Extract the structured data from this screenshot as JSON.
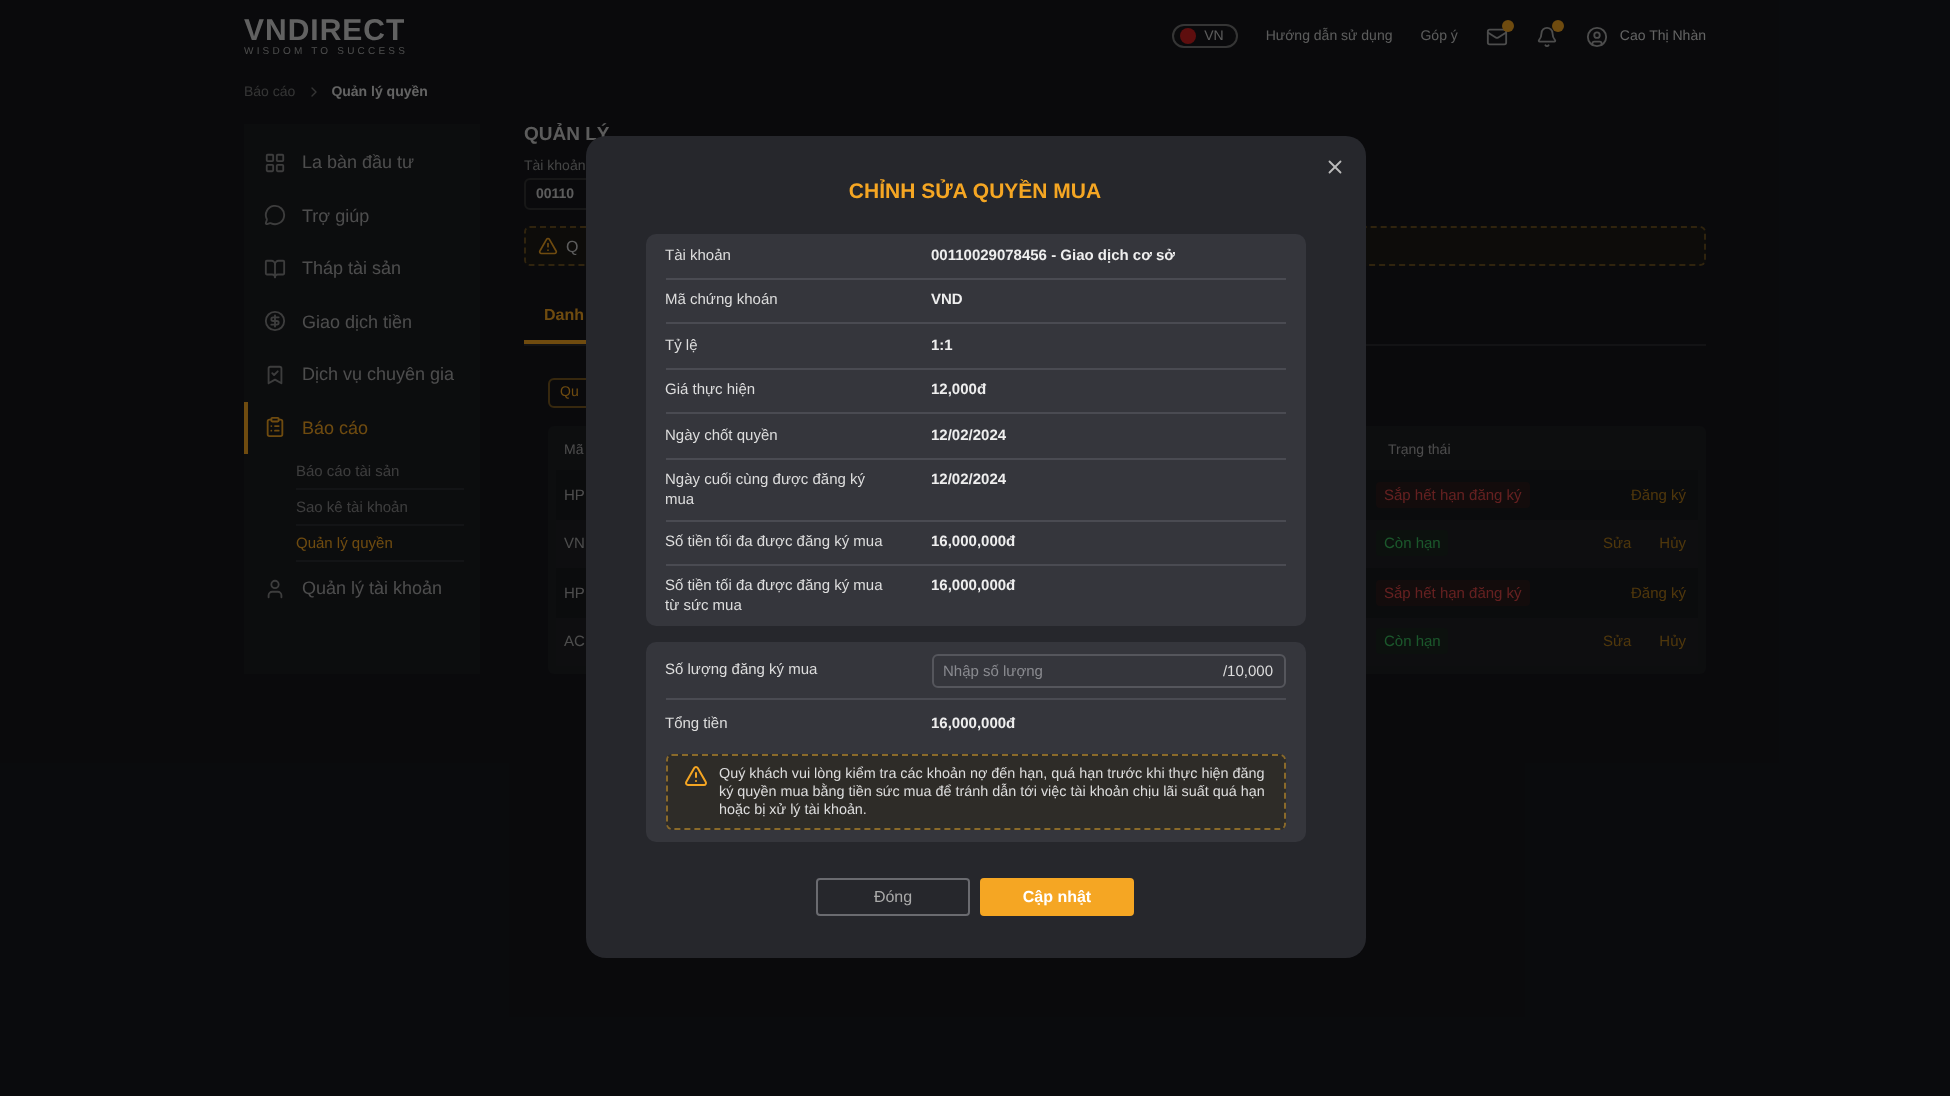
{
  "header": {
    "logo": "VNDIRECT",
    "tagline": "WISDOM TO SUCCESS",
    "language": "VN",
    "links": [
      "Hướng dẫn sử dụng",
      "Góp ý"
    ],
    "user_name": "Cao Thị Nhàn"
  },
  "breadcrumb": [
    "Báo cáo",
    "Quản lý quyền"
  ],
  "sidebar": {
    "items": [
      {
        "label": "La bàn đầu tư",
        "kind": "compass",
        "selected": false
      },
      {
        "label": "Trợ giúp",
        "kind": "help",
        "selected": false
      },
      {
        "label": "Tháp tài sản",
        "kind": "book",
        "selected": false
      },
      {
        "label": "Giao dịch tiền",
        "kind": "money",
        "selected": false
      },
      {
        "label": "Dịch vụ chuyên gia",
        "kind": "badge",
        "selected": false
      },
      {
        "label": "Báo cáo",
        "kind": "report",
        "selected": true,
        "children": [
          {
            "label": "Báo cáo tài sản",
            "selected": false
          },
          {
            "label": "Sao kê tài khoản",
            "selected": false
          },
          {
            "label": "Quản lý quyền",
            "selected": true
          }
        ]
      },
      {
        "label": "Quản lý tài khoản",
        "kind": "user",
        "selected": false
      }
    ]
  },
  "page": {
    "title": "QUẢN LÝ",
    "account_label": "Tài khoản",
    "account_value": "00110",
    "notice": "Q",
    "tabs": [
      {
        "label": "Danh",
        "selected": true
      }
    ],
    "filter_button": "Qu",
    "table": {
      "columns": [
        "Mã",
        "Trạng thái"
      ],
      "rows": [
        {
          "code": "HP",
          "status": {
            "label": "Sắp hết hạn đăng ký",
            "kind": "expiring"
          },
          "actions": [
            "Đăng ký"
          ]
        },
        {
          "code": "VN",
          "status": {
            "label": "Còn hạn",
            "kind": "valid"
          },
          "actions": [
            "Sửa",
            "Hủy"
          ]
        },
        {
          "code": "HP",
          "status": {
            "label": "Sắp hết hạn đăng ký",
            "kind": "expiring"
          },
          "actions": [
            "Đăng ký"
          ]
        },
        {
          "code": "AC",
          "status": {
            "label": "Còn hạn",
            "kind": "valid"
          },
          "actions": [
            "Sửa",
            "Hủy"
          ]
        }
      ]
    }
  },
  "dialog": {
    "title": "CHỈNH SỬA QUYỀN MUA",
    "details": [
      {
        "label": "Tài khoản",
        "value": "00110029078456 - Giao dịch cơ sở"
      },
      {
        "label": "Mã chứng khoán",
        "value": "VND"
      },
      {
        "label": "Tỷ lệ",
        "value": "1:1"
      },
      {
        "label": "Giá thực hiện",
        "value": "12,000đ"
      },
      {
        "label": "Ngày chốt quyền",
        "value": "12/02/2024"
      },
      {
        "label": "Ngày cuối cùng được đăng ký mua",
        "value": "12/02/2024"
      },
      {
        "label": "Số tiền tối đa được đăng ký mua",
        "value": "16,000,000đ"
      },
      {
        "label": "Số tiền tối đa được đăng ký mua từ sức mua",
        "value": "16,000,000đ"
      }
    ],
    "quantity": {
      "label": "Số lượng đăng ký mua",
      "placeholder": "Nhập số lượng",
      "max": "/10,000"
    },
    "total": {
      "label": "Tổng tiền",
      "value": "16,000,000đ"
    },
    "warning": "Quý khách vui lòng kiểm tra các khoản nợ đến hạn, quá hạn trước khi thực hiện đăng ký quyền mua bằng tiền sức mua để tránh dẫn tới việc tài khoản chịu lãi suất quá hạn hoặc bị xử lý tài khoản.",
    "buttons": [
      {
        "label": "Đóng",
        "kind": "secondary"
      },
      {
        "label": "Cập nhật",
        "kind": "primary"
      }
    ]
  }
}
